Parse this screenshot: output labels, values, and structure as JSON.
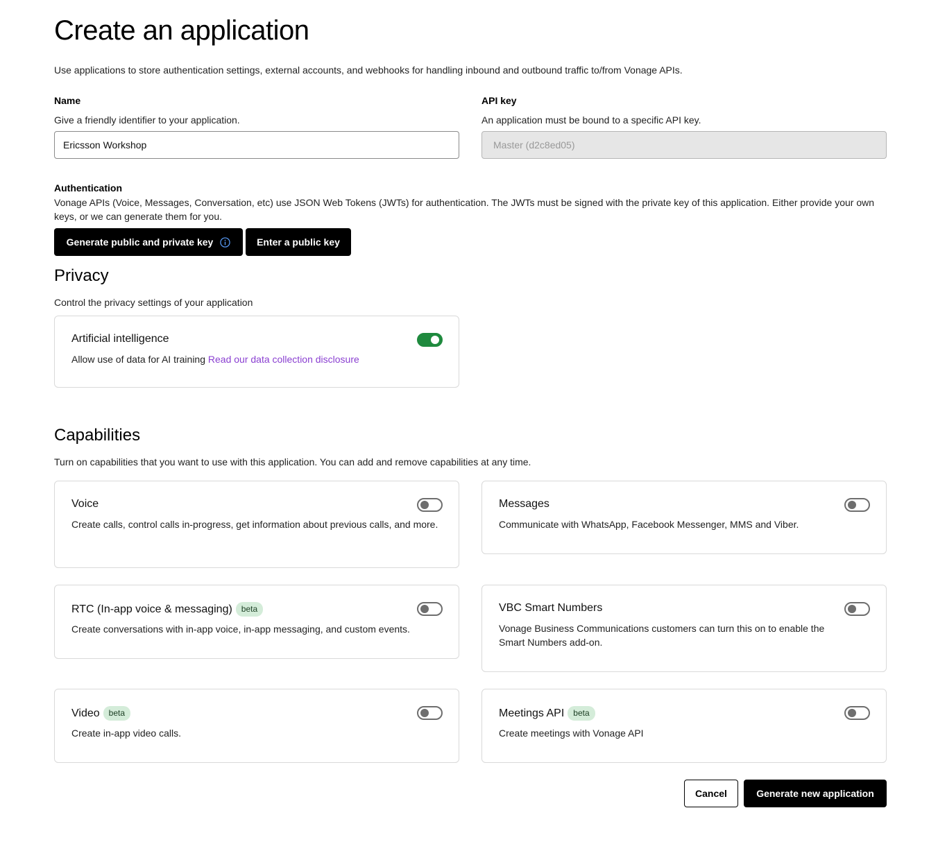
{
  "page": {
    "title": "Create an application",
    "intro": "Use applications to store authentication settings, external accounts, and webhooks for handling inbound and outbound traffic to/from Vonage APIs."
  },
  "name_field": {
    "label": "Name",
    "help": "Give a friendly identifier to your application.",
    "value": "Ericsson Workshop"
  },
  "api_key_field": {
    "label": "API key",
    "help": "An application must be bound to a specific API key.",
    "value": "Master (d2c8ed05)"
  },
  "authentication": {
    "label": "Authentication",
    "description": "Vonage APIs (Voice, Messages, Conversation, etc) use JSON Web Tokens (JWTs) for authentication. The JWTs must be signed with the private key of this application. Either provide your own keys, or we can generate them for you.",
    "generate_button": "Generate public and private key",
    "enter_button": "Enter a public key",
    "info_icon": "info-circle-icon"
  },
  "privacy": {
    "title": "Privacy",
    "description": "Control the privacy settings of your application",
    "ai_card": {
      "title": "Artificial intelligence",
      "text": "Allow use of data for AI training",
      "link": "Read our data collection disclosure",
      "enabled": true
    }
  },
  "capabilities": {
    "title": "Capabilities",
    "description": "Turn on capabilities that you want to use with this application. You can add and remove capabilities at any time.",
    "items": [
      {
        "title": "Voice",
        "badge": "",
        "description": "Create calls, control calls in-progress, get information about previous calls, and more.",
        "enabled": false
      },
      {
        "title": "Messages",
        "badge": "",
        "description": "Communicate with WhatsApp, Facebook Messenger, MMS and Viber.",
        "enabled": false
      },
      {
        "title": "RTC (In-app voice & messaging)",
        "badge": "beta",
        "description": "Create conversations with in-app voice, in-app messaging, and custom events.",
        "enabled": false
      },
      {
        "title": "VBC Smart Numbers",
        "badge": "",
        "description": "Vonage Business Communications customers can turn this on to enable the Smart Numbers add-on.",
        "enabled": false
      },
      {
        "title": "Video",
        "badge": "beta",
        "description": "Create in-app video calls.",
        "enabled": false
      },
      {
        "title": "Meetings API",
        "badge": "beta",
        "description": "Create meetings with Vonage API",
        "enabled": false
      }
    ]
  },
  "footer": {
    "cancel": "Cancel",
    "submit": "Generate new application"
  },
  "colors": {
    "toggle_on": "#1f8a3e",
    "link": "#8a3fd1",
    "badge_bg": "#d4ecd9"
  }
}
